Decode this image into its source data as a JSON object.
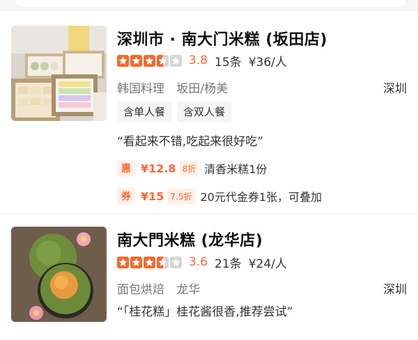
{
  "shops": [
    {
      "name": "深圳市 · 南大门米糕 (坂田店)",
      "rating": {
        "score": "3.8",
        "stars": 3.5
      },
      "reviews": "15条",
      "price": "¥36/人",
      "category": "韩国料理",
      "area": "坂田/杨美",
      "city": "深圳",
      "tags": [
        "含单人餐",
        "含双人餐"
      ],
      "quote": "“看起来不错,吃起来很好吃”",
      "deals": [
        {
          "badge": "惠",
          "price": "¥12.8",
          "discount": "8折",
          "text": "清香米糕1份"
        },
        {
          "badge": "券",
          "price": "¥15",
          "discount": "7.5折",
          "text": "20元代金券1张，可叠加"
        }
      ]
    },
    {
      "name": "南大門米糕 (龙华店)",
      "rating": {
        "score": "3.6",
        "stars": 3.5
      },
      "reviews": "21条",
      "price": "¥24/人",
      "category": "面包烘焙",
      "area": "龙华",
      "city": "深圳",
      "quote": "“「桂花糕」桂花酱很香,推荐尝试”"
    }
  ],
  "colors": {
    "accent": "#ff6633",
    "star": "#f5692e",
    "star_empty": "#d6d6d6"
  }
}
